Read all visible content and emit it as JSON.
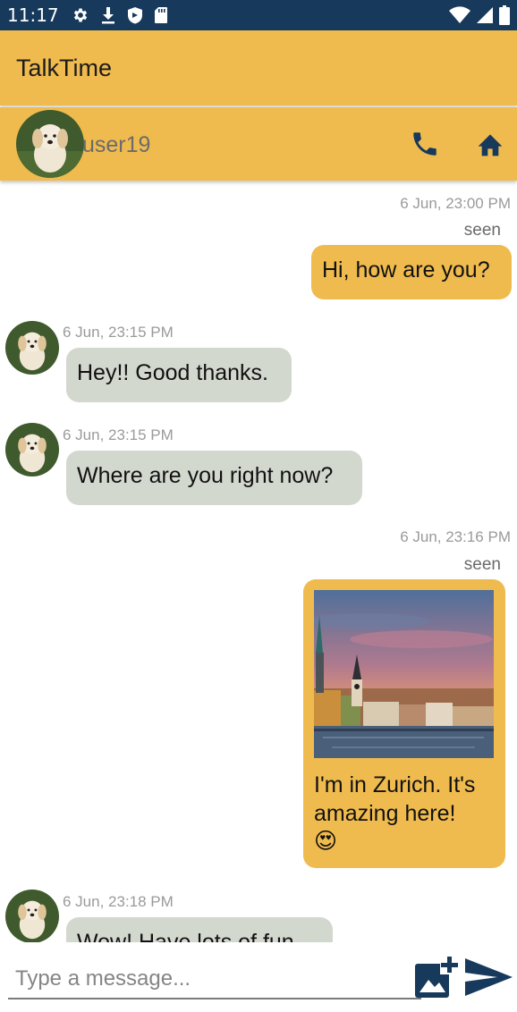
{
  "status_bar": {
    "time": "11:17",
    "icons_left": [
      "settings-icon",
      "download-icon",
      "shield-icon",
      "sd-card-icon"
    ],
    "icons_right": [
      "wifi-icon",
      "signal-icon",
      "battery-icon"
    ]
  },
  "app_bar": {
    "title": "TalkTime"
  },
  "chat_header": {
    "username": "user19",
    "actions": [
      "call-icon",
      "home-icon"
    ]
  },
  "messages": [
    {
      "direction": "out",
      "timestamp": "6 Jun, 23:00 PM",
      "status": "seen",
      "text": "Hi, how are you?"
    },
    {
      "direction": "in",
      "timestamp": "6 Jun, 23:15 PM",
      "text": "Hey!! Good thanks."
    },
    {
      "direction": "in",
      "timestamp": "6 Jun, 23:15 PM",
      "text": "Where are you right now?"
    },
    {
      "direction": "out",
      "timestamp": "6 Jun, 23:16 PM",
      "status": "seen",
      "image": "zurich-photo",
      "text": "I'm in Zurich. It's amazing here!",
      "emoji": "😍"
    },
    {
      "direction": "in",
      "timestamp": "6 Jun, 23:18 PM",
      "text": "Wow! Have lots of fun"
    }
  ],
  "input": {
    "placeholder": "Type a message..."
  },
  "colors": {
    "status_bar": "#173a5c",
    "accent": "#f0bb4e",
    "incoming_bubble": "#d3d8cf",
    "icon": "#173a5c"
  }
}
